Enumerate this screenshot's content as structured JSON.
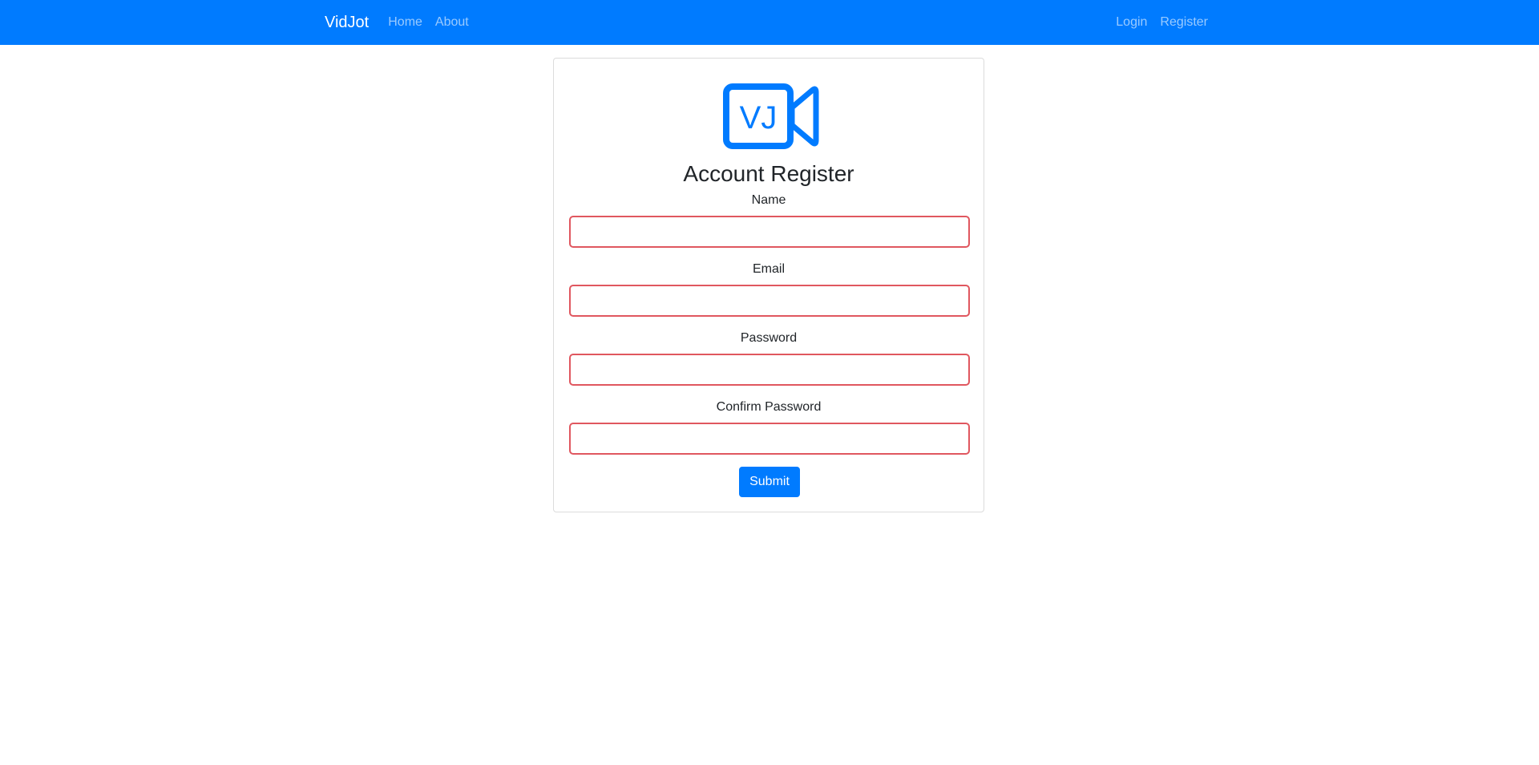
{
  "navbar": {
    "brand": "VidJot",
    "left_links": [
      {
        "label": "Home"
      },
      {
        "label": "About"
      }
    ],
    "right_links": [
      {
        "label": "Login"
      },
      {
        "label": "Register"
      }
    ],
    "background_color": "#007bff"
  },
  "logo": {
    "text": "VJ",
    "icon": "video-camera-icon",
    "color": "#007bff"
  },
  "form": {
    "title": "Account Register",
    "fields": [
      {
        "label": "Name",
        "value": "",
        "placeholder": ""
      },
      {
        "label": "Email",
        "value": "",
        "placeholder": ""
      },
      {
        "label": "Password",
        "value": "",
        "placeholder": ""
      },
      {
        "label": "Confirm Password",
        "value": "",
        "placeholder": ""
      }
    ],
    "invalid_border_color": "#e0575f",
    "submit_label": "Submit"
  }
}
